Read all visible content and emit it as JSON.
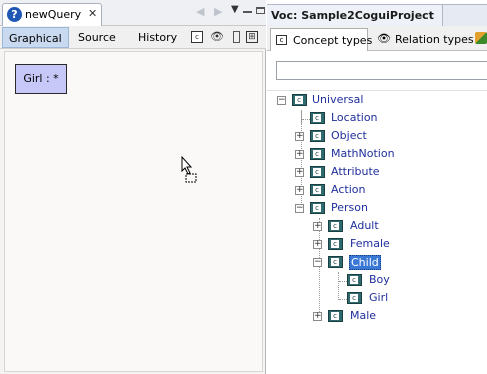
{
  "left": {
    "editor_tab_label": "newQuery",
    "view_tabs": [
      "Graphical",
      "Source",
      "History"
    ],
    "node_label": "Girl : *"
  },
  "right": {
    "voc_title": "Voc: Sample2CoguiProject",
    "tabs": [
      "Concept types",
      "Relation types"
    ],
    "search": {
      "value": "",
      "placeholder": ""
    },
    "tree": [
      {
        "label": "Universal",
        "depth": 0,
        "expander": "minus",
        "selected": false
      },
      {
        "label": "Location",
        "depth": 1,
        "expander": "none",
        "selected": false
      },
      {
        "label": "Object",
        "depth": 1,
        "expander": "plus",
        "selected": false
      },
      {
        "label": "MathNotion",
        "depth": 1,
        "expander": "plus",
        "selected": false
      },
      {
        "label": "Attribute",
        "depth": 1,
        "expander": "plus",
        "selected": false
      },
      {
        "label": "Action",
        "depth": 1,
        "expander": "plus",
        "selected": false
      },
      {
        "label": "Person",
        "depth": 1,
        "expander": "minus",
        "selected": false
      },
      {
        "label": "Adult",
        "depth": 2,
        "expander": "plus",
        "selected": false
      },
      {
        "label": "Female",
        "depth": 2,
        "expander": "plus",
        "selected": false
      },
      {
        "label": "Child",
        "depth": 2,
        "expander": "minus",
        "selected": true
      },
      {
        "label": "Boy",
        "depth": 3,
        "expander": "none",
        "selected": false
      },
      {
        "label": "Girl",
        "depth": 3,
        "expander": "none",
        "selected": false
      },
      {
        "label": "Male",
        "depth": 2,
        "expander": "plus",
        "selected": false
      }
    ]
  },
  "colors": {
    "node_fill": "#c8c8f8",
    "selection": "#3a78d6",
    "tree_text": "#1f2f9c",
    "active_view_tab": "#c9d9ef"
  }
}
